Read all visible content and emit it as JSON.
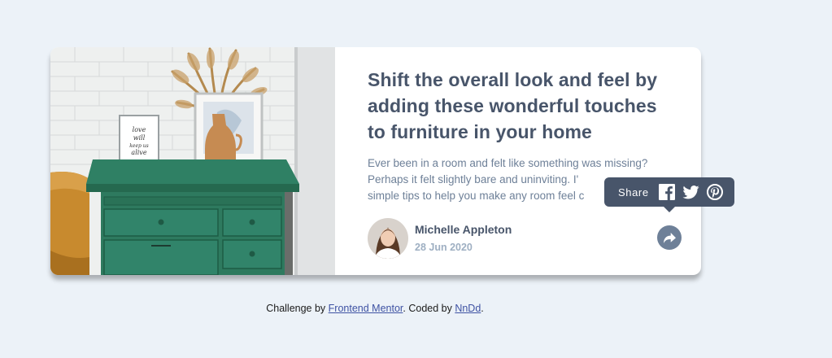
{
  "card": {
    "title": "Shift the overall look and feel by adding these wonderful touches to furniture in your home",
    "excerpt_lines": [
      "Ever been in a room and felt like something was missing?",
      "Perhaps it felt slightly bare and uninviting. I'",
      "simple tips to help you make any room feel c"
    ],
    "frame_text": [
      "love",
      "will",
      "keep us",
      "alive"
    ],
    "author": {
      "name": "Michelle Appleton",
      "date": "28 Jun 2020"
    }
  },
  "share": {
    "label": "Share",
    "icons": [
      "facebook-icon",
      "twitter-icon",
      "pinterest-icon"
    ],
    "button_icon": "share-arrow-icon"
  },
  "footer": {
    "prefix": "Challenge by ",
    "link1": "Frontend Mentor",
    "middle": ". Coded by ",
    "link2": "NnDd",
    "suffix": "."
  },
  "colors": {
    "background": "#ecf2f8",
    "title": "#48556a",
    "text": "#6e8098",
    "date": "#9eafc2",
    "tooltip": "#48556a"
  }
}
